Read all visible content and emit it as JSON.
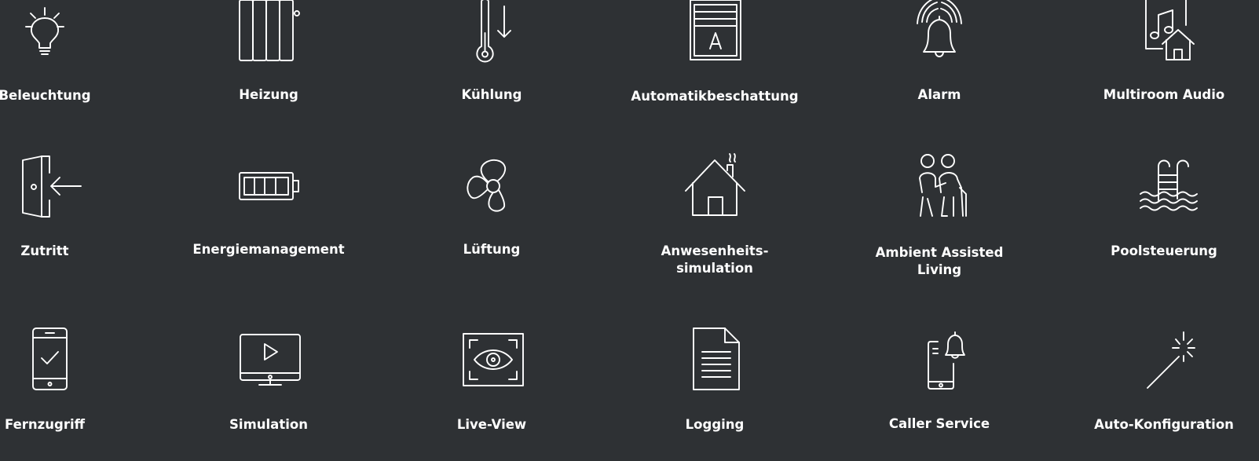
{
  "features": [
    {
      "label": "Beleuchtung",
      "icon": "light-bulb-icon"
    },
    {
      "label": "Heizung",
      "icon": "radiator-icon"
    },
    {
      "label": "Kühlung",
      "icon": "thermometer-down-icon"
    },
    {
      "label": "Automatikbeschattung",
      "icon": "window-shade-icon"
    },
    {
      "label": "Alarm",
      "icon": "alarm-bell-icon"
    },
    {
      "label": "Multiroom Audio",
      "icon": "music-house-icon"
    },
    {
      "label": "Zutritt",
      "icon": "door-entry-icon"
    },
    {
      "label": "Energiemanagement",
      "icon": "battery-icon"
    },
    {
      "label": "Lüftung",
      "icon": "fan-icon"
    },
    {
      "label": "Anwesenheits-",
      "label2": "simulation",
      "icon": "house-chimney-icon"
    },
    {
      "label": "Ambient Assisted",
      "label2": "Living",
      "icon": "elderly-assist-icon"
    },
    {
      "label": "Poolsteuerung",
      "icon": "pool-ladder-icon"
    },
    {
      "label": "Fernzugriff",
      "icon": "phone-check-icon"
    },
    {
      "label": "Simulation",
      "icon": "monitor-play-icon"
    },
    {
      "label": "Live-View",
      "icon": "eye-camera-icon"
    },
    {
      "label": "Logging",
      "icon": "document-icon"
    },
    {
      "label": "Caller Service",
      "icon": "phone-bell-icon"
    },
    {
      "label": "Auto-Konfiguration",
      "icon": "magic-wand-icon"
    }
  ],
  "colors": {
    "background": "#2e3134",
    "foreground": "#ffffff"
  }
}
